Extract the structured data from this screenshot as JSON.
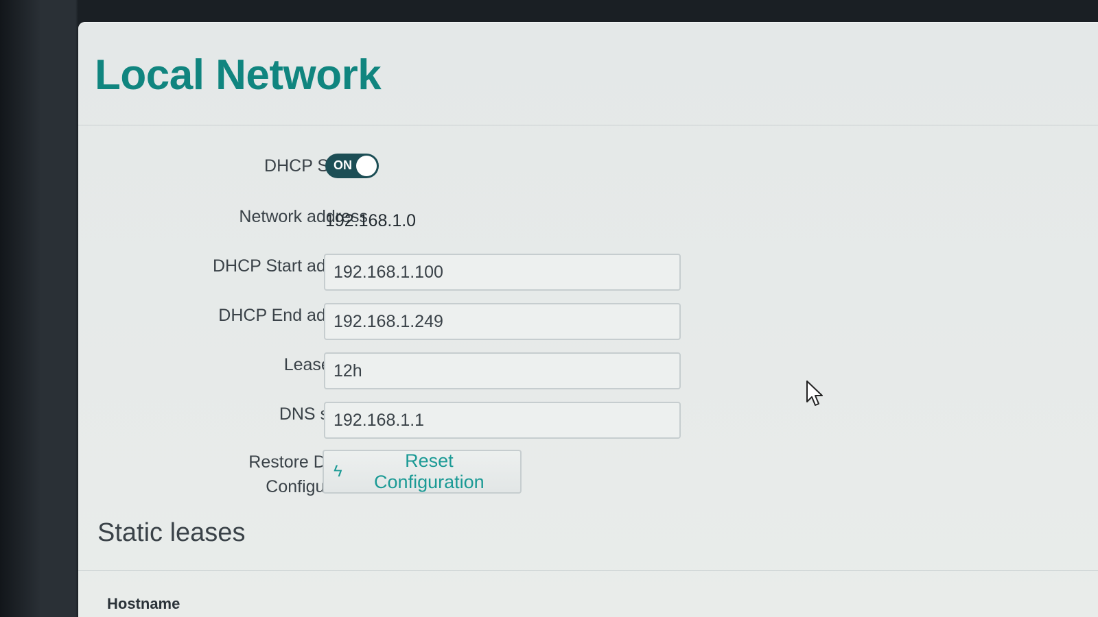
{
  "page": {
    "title": "Local Network"
  },
  "form": {
    "dhcp_server": {
      "label": "DHCP Server",
      "toggle_text": "ON",
      "enabled": true
    },
    "network_address": {
      "label": "Network address",
      "value": "192.168.1.0"
    },
    "dhcp_start": {
      "label": "DHCP Start address",
      "value": "192.168.1.100"
    },
    "dhcp_end": {
      "label": "DHCP End address",
      "value": "192.168.1.249"
    },
    "lease_time": {
      "label": "Lease time",
      "value": "12h"
    },
    "dns_server": {
      "label": "DNS server",
      "value": "192.168.1.1"
    },
    "restore": {
      "label_line1": "Restore Default",
      "label_line2": "Configuration",
      "button_label": "Reset Configuration",
      "button_icon": "bolt-icon"
    }
  },
  "static_leases": {
    "title": "Static leases",
    "column_header": "Hostname"
  },
  "colors": {
    "accent": "#10857f",
    "toggle_on": "#1c4e55",
    "link": "#1b9a95"
  }
}
